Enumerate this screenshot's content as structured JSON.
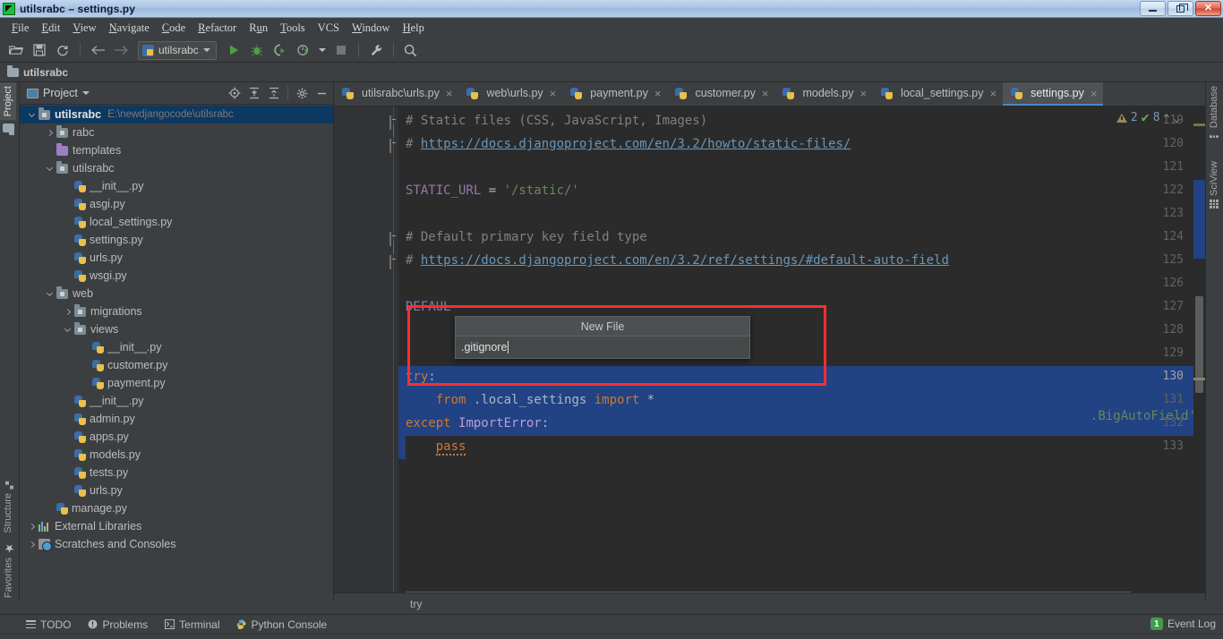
{
  "window": {
    "title": "utilsrabc – settings.py",
    "app_icon": "pycharm-icon",
    "buttons": {
      "minimize": "minimize",
      "maximize": "maximize",
      "close": "close"
    }
  },
  "menubar": {
    "items": [
      {
        "label": "File",
        "mnemonic": "F"
      },
      {
        "label": "Edit",
        "mnemonic": "E"
      },
      {
        "label": "View",
        "mnemonic": "V"
      },
      {
        "label": "Navigate",
        "mnemonic": "N"
      },
      {
        "label": "Code",
        "mnemonic": "C"
      },
      {
        "label": "Refactor",
        "mnemonic": "R"
      },
      {
        "label": "Run",
        "mnemonic": "u"
      },
      {
        "label": "Tools",
        "mnemonic": "T"
      },
      {
        "label": "VCS",
        "mnemonic": ""
      },
      {
        "label": "Window",
        "mnemonic": "W"
      },
      {
        "label": "Help",
        "mnemonic": "H"
      }
    ]
  },
  "toolbar": {
    "open_icon": "open-folder-icon",
    "save_icon": "save-icon",
    "sync_icon": "sync-icon",
    "back_icon": "arrow-left-icon",
    "forward_icon": "arrow-right-icon",
    "run_config": "utilsrabc",
    "run_icon": "run-icon",
    "debug_icon": "debug-bug-icon",
    "run_coverage_icon": "run-with-coverage-icon",
    "profile_icon": "profile-icon",
    "stop_icon": "stop-icon",
    "settings_icon": "wrench-icon",
    "search_icon": "search-icon"
  },
  "pathbar": {
    "label": "utilsrabc",
    "icon": "folder-icon"
  },
  "left_strip": {
    "tabs": [
      {
        "label": "Project",
        "active": true,
        "icon": ""
      },
      {
        "label": "",
        "active": false,
        "icon": "folder-icon"
      },
      {
        "label": "Structure",
        "active": false,
        "icon": "structure-icon"
      },
      {
        "label": "Favorites",
        "active": false,
        "icon": "star-icon"
      }
    ]
  },
  "right_strip": {
    "tabs": [
      {
        "label": "Database",
        "icon": "database-icon"
      },
      {
        "label": "SciView",
        "icon": "grid-icon"
      }
    ]
  },
  "project_panel": {
    "title": "Project",
    "title_icon": "project-icon",
    "dropdown_icon": "chevron-down-icon",
    "actions": [
      {
        "name": "locate-icon"
      },
      {
        "name": "expand-all-icon"
      },
      {
        "name": "collapse-all-icon"
      },
      {
        "name": "settings-gear-icon"
      },
      {
        "name": "hide-icon"
      }
    ],
    "tree": [
      {
        "label": "utilsrabc",
        "path": "E:\\newdjangocode\\utilsrabc",
        "depth": 0,
        "arrow": "down",
        "icon": "module-folder",
        "bold": true,
        "selected": true
      },
      {
        "label": "rabc",
        "depth": 1,
        "arrow": "right",
        "icon": "module-folder"
      },
      {
        "label": "templates",
        "depth": 1,
        "arrow": "none",
        "icon": "resource-folder"
      },
      {
        "label": "utilsrabc",
        "depth": 1,
        "arrow": "down",
        "icon": "module-folder"
      },
      {
        "label": "__init__.py",
        "depth": 2,
        "arrow": "none",
        "icon": "python-file"
      },
      {
        "label": "asgi.py",
        "depth": 2,
        "arrow": "none",
        "icon": "python-file"
      },
      {
        "label": "local_settings.py",
        "depth": 2,
        "arrow": "none",
        "icon": "python-file"
      },
      {
        "label": "settings.py",
        "depth": 2,
        "arrow": "none",
        "icon": "python-file"
      },
      {
        "label": "urls.py",
        "depth": 2,
        "arrow": "none",
        "icon": "python-file"
      },
      {
        "label": "wsgi.py",
        "depth": 2,
        "arrow": "none",
        "icon": "python-file"
      },
      {
        "label": "web",
        "depth": 1,
        "arrow": "down",
        "icon": "module-folder"
      },
      {
        "label": "migrations",
        "depth": 2,
        "arrow": "right",
        "icon": "module-folder"
      },
      {
        "label": "views",
        "depth": 2,
        "arrow": "down",
        "icon": "module-folder"
      },
      {
        "label": "__init__.py",
        "depth": 3,
        "arrow": "none",
        "icon": "python-file"
      },
      {
        "label": "customer.py",
        "depth": 3,
        "arrow": "none",
        "icon": "python-file"
      },
      {
        "label": "payment.py",
        "depth": 3,
        "arrow": "none",
        "icon": "python-file"
      },
      {
        "label": "__init__.py",
        "depth": 2,
        "arrow": "none",
        "icon": "python-file"
      },
      {
        "label": "admin.py",
        "depth": 2,
        "arrow": "none",
        "icon": "python-file"
      },
      {
        "label": "apps.py",
        "depth": 2,
        "arrow": "none",
        "icon": "python-file"
      },
      {
        "label": "models.py",
        "depth": 2,
        "arrow": "none",
        "icon": "python-file"
      },
      {
        "label": "tests.py",
        "depth": 2,
        "arrow": "none",
        "icon": "python-file"
      },
      {
        "label": "urls.py",
        "depth": 2,
        "arrow": "none",
        "icon": "python-file"
      },
      {
        "label": "manage.py",
        "depth": 1,
        "arrow": "none",
        "icon": "python-file"
      },
      {
        "label": "External Libraries",
        "depth": 0,
        "arrow": "right",
        "icon": "library-icon"
      },
      {
        "label": "Scratches and Consoles",
        "depth": 0,
        "arrow": "right",
        "icon": "scratches-icon"
      }
    ]
  },
  "editor": {
    "tabs": [
      {
        "label": "utilsrabc\\urls.py",
        "active": false,
        "icon": "python-file",
        "close": "×"
      },
      {
        "label": "web\\urls.py",
        "active": false,
        "icon": "python-file",
        "close": "×"
      },
      {
        "label": "payment.py",
        "active": false,
        "icon": "python-file",
        "close": "×"
      },
      {
        "label": "customer.py",
        "active": false,
        "icon": "python-file",
        "close": "×"
      },
      {
        "label": "models.py",
        "active": false,
        "icon": "python-file",
        "close": "×"
      },
      {
        "label": "local_settings.py",
        "active": false,
        "icon": "python-file",
        "close": "×"
      },
      {
        "label": "settings.py",
        "active": true,
        "icon": "python-file",
        "close": "×"
      }
    ],
    "inspection": {
      "warning_icon": "warning-triangle-icon",
      "warning_count": "2",
      "ok_icon": "check-icon",
      "ok_count": "8",
      "prev_icon": "chevron-up-icon",
      "next_icon": "chevron-down-icon"
    },
    "first_line_number": 119,
    "lines": [
      {
        "no": "119",
        "fold": "start",
        "tokens": [
          {
            "t": "# Static files (CSS, JavaScript, Images)",
            "c": "c-comment"
          }
        ]
      },
      {
        "no": "120",
        "fold": "end",
        "tokens": [
          {
            "t": "# ",
            "c": "c-comment"
          },
          {
            "t": "https://docs.djangoproject.com/en/3.2/howto/static-files/",
            "c": "c-link"
          }
        ]
      },
      {
        "no": "121",
        "fold": "none",
        "tokens": []
      },
      {
        "no": "122",
        "fold": "none",
        "tokens": [
          {
            "t": "STATIC_URL ",
            "c": "c-const"
          },
          {
            "t": "= ",
            "c": "c-op"
          },
          {
            "t": "'/static/'",
            "c": "c-str"
          }
        ]
      },
      {
        "no": "123",
        "fold": "none",
        "tokens": []
      },
      {
        "no": "124",
        "fold": "start",
        "tokens": [
          {
            "t": "# Default primary key field type",
            "c": "c-comment"
          }
        ]
      },
      {
        "no": "125",
        "fold": "end",
        "tokens": [
          {
            "t": "# ",
            "c": "c-comment"
          },
          {
            "t": "https://docs.djangoproject.com/en/3.2/ref/settings/#default-auto-field",
            "c": "c-link"
          }
        ]
      },
      {
        "no": "126",
        "fold": "none",
        "tokens": []
      },
      {
        "no": "127",
        "fold": "none",
        "tokens": [
          {
            "t": "DEFAUL",
            "c": "c-const"
          }
        ]
      },
      {
        "no": "128",
        "fold": "none",
        "tokens": []
      },
      {
        "no": "129",
        "fold": "none",
        "tokens": []
      },
      {
        "no": "130",
        "fold": "none",
        "selected": true,
        "current": true,
        "tokens": [
          {
            "t": "try",
            "c": "c-kw"
          },
          {
            "t": ":",
            "c": "c-op"
          }
        ]
      },
      {
        "no": "131",
        "fold": "none",
        "selected": true,
        "tokens": [
          {
            "t": "    ",
            "c": "c-op"
          },
          {
            "t": "from ",
            "c": "c-kw"
          },
          {
            "t": ".local_settings ",
            "c": "c-ident"
          },
          {
            "t": "import ",
            "c": "c-kw"
          },
          {
            "t": "*",
            "c": "c-ident"
          }
        ]
      },
      {
        "no": "132",
        "fold": "none",
        "selected": true,
        "tokens": [
          {
            "t": "except ",
            "c": "c-kw"
          },
          {
            "t": "ImportError",
            "c": "c-except"
          },
          {
            "t": ":",
            "c": "c-op"
          }
        ]
      },
      {
        "no": "133",
        "fold": "none",
        "selected": true,
        "tokens": [
          {
            "t": "    ",
            "c": "c-op"
          },
          {
            "t": "pass",
            "c": "c-kw"
          }
        ]
      }
    ],
    "line_127_tail": ".BigAutoField'",
    "breadcrumb": "try"
  },
  "new_file_popup": {
    "title": "New File",
    "value": ".gitignore",
    "highlight_color": "#ff2d2d"
  },
  "bottom_bar": {
    "items": [
      {
        "label": "TODO",
        "icon": "todo-list-icon"
      },
      {
        "label": "Problems",
        "icon": "problems-icon"
      },
      {
        "label": "Terminal",
        "icon": "terminal-icon"
      },
      {
        "label": "Python Console",
        "icon": "python-console-icon"
      }
    ],
    "event_log": {
      "label": "Event Log",
      "count": "1"
    }
  }
}
